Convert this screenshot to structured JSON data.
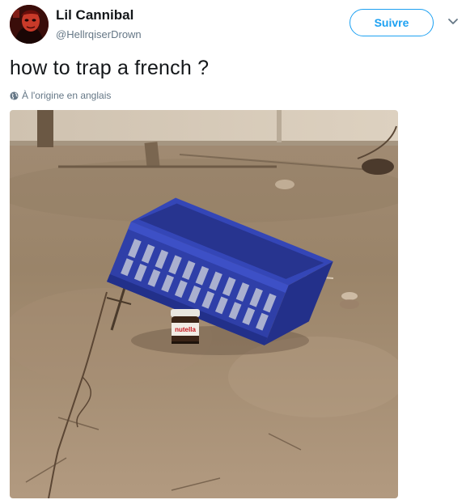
{
  "user": {
    "display_name": "Lil Cannibal",
    "handle": "@HellrqiserDrown",
    "avatar_icon": "avatar-red-portrait"
  },
  "follow": {
    "label": "Suivre"
  },
  "menu": {
    "icon": "chevron-down-icon"
  },
  "tweet": {
    "text": "how to trap a french ?",
    "translation_note": "À l'origine en anglais",
    "translation_icon": "globe-icon"
  },
  "media": {
    "jar_label": "nutella"
  },
  "colors": {
    "accent": "#1da1f2",
    "text": "#14171a",
    "secondary": "#657786"
  }
}
